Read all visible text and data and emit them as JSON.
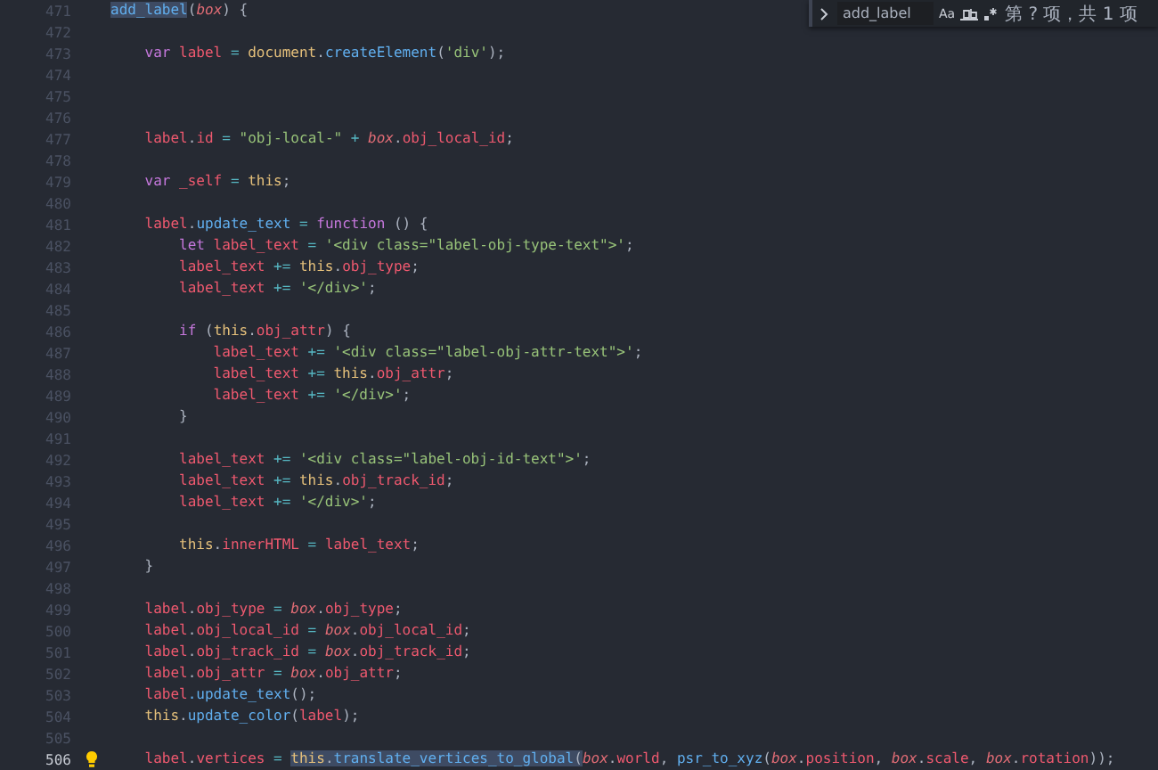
{
  "find_widget": {
    "query": "add_label",
    "match_case_label": "Aa",
    "result": "第 ? 项，共 1 项"
  },
  "editor": {
    "lines": [
      {
        "n": "471",
        "current": false,
        "tokens": [
          {
            "text": "add_label",
            "kind": "fn",
            "highlighted": true
          },
          {
            "text": "(",
            "kind": "punc"
          },
          {
            "text": "box",
            "kind": "param"
          },
          {
            "text": ") {",
            "kind": "punc"
          }
        ]
      },
      {
        "n": "472",
        "current": false
      },
      {
        "n": "473",
        "current": false,
        "tokens": [
          {
            "text": "    var",
            "kind": "kw"
          },
          {
            "text": " label",
            "kind": "var"
          },
          {
            "text": " = ",
            "kind": "op"
          },
          {
            "text": "document",
            "kind": "obj"
          },
          {
            "text": ".",
            "kind": "punc"
          },
          {
            "text": "createElement",
            "kind": "fn"
          },
          {
            "text": "(",
            "kind": "punc"
          },
          {
            "text": "'div'",
            "kind": "str"
          },
          {
            "text": ");",
            "kind": "punc"
          }
        ]
      },
      {
        "n": "474",
        "current": false
      },
      {
        "n": "475",
        "current": false
      },
      {
        "n": "476",
        "current": false
      },
      {
        "n": "477",
        "current": false,
        "tokens": [
          {
            "text": "    label",
            "kind": "var"
          },
          {
            "text": ".",
            "kind": "punc"
          },
          {
            "text": "id",
            "kind": "var"
          },
          {
            "text": " = ",
            "kind": "op"
          },
          {
            "text": "\"obj-local-\"",
            "kind": "str"
          },
          {
            "text": " + ",
            "kind": "op"
          },
          {
            "text": "box",
            "kind": "param"
          },
          {
            "text": ".",
            "kind": "punc"
          },
          {
            "text": "obj_local_id",
            "kind": "var"
          },
          {
            "text": ";",
            "kind": "punc"
          }
        ]
      },
      {
        "n": "478",
        "current": false
      },
      {
        "n": "479",
        "current": false,
        "tokens": [
          {
            "text": "    var",
            "kind": "kw"
          },
          {
            "text": " _self",
            "kind": "var"
          },
          {
            "text": " = ",
            "kind": "op"
          },
          {
            "text": "this",
            "kind": "this"
          },
          {
            "text": ";",
            "kind": "punc"
          }
        ]
      },
      {
        "n": "480",
        "current": false
      },
      {
        "n": "481",
        "current": false,
        "tokens": [
          {
            "text": "    label",
            "kind": "var"
          },
          {
            "text": ".",
            "kind": "punc"
          },
          {
            "text": "update_text",
            "kind": "fn"
          },
          {
            "text": " = ",
            "kind": "op"
          },
          {
            "text": "function",
            "kind": "kw"
          },
          {
            "text": " () {",
            "kind": "punc"
          }
        ]
      },
      {
        "n": "482",
        "current": false,
        "tokens": [
          {
            "text": "        let",
            "kind": "kw"
          },
          {
            "text": " label_text",
            "kind": "var"
          },
          {
            "text": " = ",
            "kind": "op"
          },
          {
            "text": "'<div class=\"label-obj-type-text\">'",
            "kind": "str"
          },
          {
            "text": ";",
            "kind": "punc"
          }
        ]
      },
      {
        "n": "483",
        "current": false,
        "tokens": [
          {
            "text": "        label_text",
            "kind": "var"
          },
          {
            "text": " += ",
            "kind": "op"
          },
          {
            "text": "this",
            "kind": "this"
          },
          {
            "text": ".",
            "kind": "punc"
          },
          {
            "text": "obj_type",
            "kind": "var"
          },
          {
            "text": ";",
            "kind": "punc"
          }
        ]
      },
      {
        "n": "484",
        "current": false,
        "tokens": [
          {
            "text": "        label_text",
            "kind": "var"
          },
          {
            "text": " += ",
            "kind": "op"
          },
          {
            "text": "'</div>'",
            "kind": "str"
          },
          {
            "text": ";",
            "kind": "punc"
          }
        ]
      },
      {
        "n": "485",
        "current": false
      },
      {
        "n": "486",
        "current": false,
        "tokens": [
          {
            "text": "        if",
            "kind": "kw"
          },
          {
            "text": " (",
            "kind": "punc"
          },
          {
            "text": "this",
            "kind": "this"
          },
          {
            "text": ".",
            "kind": "punc"
          },
          {
            "text": "obj_attr",
            "kind": "var"
          },
          {
            "text": ") {",
            "kind": "punc"
          }
        ]
      },
      {
        "n": "487",
        "current": false,
        "tokens": [
          {
            "text": "            label_text",
            "kind": "var"
          },
          {
            "text": " += ",
            "kind": "op"
          },
          {
            "text": "'<div class=\"label-obj-attr-text\">'",
            "kind": "str"
          },
          {
            "text": ";",
            "kind": "punc"
          }
        ]
      },
      {
        "n": "488",
        "current": false,
        "tokens": [
          {
            "text": "            label_text",
            "kind": "var"
          },
          {
            "text": " += ",
            "kind": "op"
          },
          {
            "text": "this",
            "kind": "this"
          },
          {
            "text": ".",
            "kind": "punc"
          },
          {
            "text": "obj_attr",
            "kind": "var"
          },
          {
            "text": ";",
            "kind": "punc"
          }
        ]
      },
      {
        "n": "489",
        "current": false,
        "tokens": [
          {
            "text": "            label_text",
            "kind": "var"
          },
          {
            "text": " += ",
            "kind": "op"
          },
          {
            "text": "'</div>'",
            "kind": "str"
          },
          {
            "text": ";",
            "kind": "punc"
          }
        ]
      },
      {
        "n": "490",
        "current": false,
        "tokens": [
          {
            "text": "        }",
            "kind": "punc"
          }
        ]
      },
      {
        "n": "491",
        "current": false
      },
      {
        "n": "492",
        "current": false,
        "tokens": [
          {
            "text": "        label_text",
            "kind": "var"
          },
          {
            "text": " += ",
            "kind": "op"
          },
          {
            "text": "'<div class=\"label-obj-id-text\">'",
            "kind": "str"
          },
          {
            "text": ";",
            "kind": "punc"
          }
        ]
      },
      {
        "n": "493",
        "current": false,
        "tokens": [
          {
            "text": "        label_text",
            "kind": "var"
          },
          {
            "text": " += ",
            "kind": "op"
          },
          {
            "text": "this",
            "kind": "this"
          },
          {
            "text": ".",
            "kind": "punc"
          },
          {
            "text": "obj_track_id",
            "kind": "var"
          },
          {
            "text": ";",
            "kind": "punc"
          }
        ]
      },
      {
        "n": "494",
        "current": false,
        "tokens": [
          {
            "text": "        label_text",
            "kind": "var"
          },
          {
            "text": " += ",
            "kind": "op"
          },
          {
            "text": "'</div>'",
            "kind": "str"
          },
          {
            "text": ";",
            "kind": "punc"
          }
        ]
      },
      {
        "n": "495",
        "current": false
      },
      {
        "n": "496",
        "current": false,
        "tokens": [
          {
            "text": "        this",
            "kind": "this"
          },
          {
            "text": ".",
            "kind": "punc"
          },
          {
            "text": "innerHTML",
            "kind": "var"
          },
          {
            "text": " = ",
            "kind": "op"
          },
          {
            "text": "label_text",
            "kind": "var"
          },
          {
            "text": ";",
            "kind": "punc"
          }
        ]
      },
      {
        "n": "497",
        "current": false,
        "tokens": [
          {
            "text": "    }",
            "kind": "punc"
          }
        ]
      },
      {
        "n": "498",
        "current": false
      },
      {
        "n": "499",
        "current": false,
        "tokens": [
          {
            "text": "    label",
            "kind": "var"
          },
          {
            "text": ".",
            "kind": "punc"
          },
          {
            "text": "obj_type",
            "kind": "var"
          },
          {
            "text": " = ",
            "kind": "op"
          },
          {
            "text": "box",
            "kind": "param"
          },
          {
            "text": ".",
            "kind": "punc"
          },
          {
            "text": "obj_type",
            "kind": "var"
          },
          {
            "text": ";",
            "kind": "punc"
          }
        ]
      },
      {
        "n": "500",
        "current": false,
        "tokens": [
          {
            "text": "    label",
            "kind": "var"
          },
          {
            "text": ".",
            "kind": "punc"
          },
          {
            "text": "obj_local_id",
            "kind": "var"
          },
          {
            "text": " = ",
            "kind": "op"
          },
          {
            "text": "box",
            "kind": "param"
          },
          {
            "text": ".",
            "kind": "punc"
          },
          {
            "text": "obj_local_id",
            "kind": "var"
          },
          {
            "text": ";",
            "kind": "punc"
          }
        ]
      },
      {
        "n": "501",
        "current": false,
        "tokens": [
          {
            "text": "    label",
            "kind": "var"
          },
          {
            "text": ".",
            "kind": "punc"
          },
          {
            "text": "obj_track_id",
            "kind": "var"
          },
          {
            "text": " = ",
            "kind": "op"
          },
          {
            "text": "box",
            "kind": "param"
          },
          {
            "text": ".",
            "kind": "punc"
          },
          {
            "text": "obj_track_id",
            "kind": "var"
          },
          {
            "text": ";",
            "kind": "punc"
          }
        ]
      },
      {
        "n": "502",
        "current": false,
        "tokens": [
          {
            "text": "    label",
            "kind": "var"
          },
          {
            "text": ".",
            "kind": "punc"
          },
          {
            "text": "obj_attr",
            "kind": "var"
          },
          {
            "text": " = ",
            "kind": "op"
          },
          {
            "text": "box",
            "kind": "param"
          },
          {
            "text": ".",
            "kind": "punc"
          },
          {
            "text": "obj_attr",
            "kind": "var"
          },
          {
            "text": ";",
            "kind": "punc"
          }
        ]
      },
      {
        "n": "503",
        "current": false,
        "tokens": [
          {
            "text": "    label",
            "kind": "var"
          },
          {
            "text": ".update_text",
            "kind": "fn"
          },
          {
            "text": "();",
            "kind": "punc"
          }
        ]
      },
      {
        "n": "504",
        "current": false,
        "tokens": [
          {
            "text": "    this",
            "kind": "this"
          },
          {
            "text": ".",
            "kind": "punc"
          },
          {
            "text": "update_color",
            "kind": "fn"
          },
          {
            "text": "(",
            "kind": "punc"
          },
          {
            "text": "label",
            "kind": "var"
          },
          {
            "text": ");",
            "kind": "punc"
          }
        ]
      },
      {
        "n": "505",
        "current": false
      },
      {
        "n": "506",
        "current": true,
        "tokens": [
          {
            "text": "    label",
            "kind": "var"
          },
          {
            "text": ".",
            "kind": "punc"
          },
          {
            "text": "vertices",
            "kind": "var"
          },
          {
            "text": " = ",
            "kind": "op"
          },
          {
            "text": "this",
            "kind": "this",
            "highlighted": true
          },
          {
            "text": ".",
            "kind": "punc",
            "highlighted": true
          },
          {
            "text": "translate_vertices_to_global",
            "kind": "fn",
            "highlighted": true
          },
          {
            "text": "(",
            "kind": "punc",
            "highlighted": true
          },
          {
            "text": "box",
            "kind": "param"
          },
          {
            "text": ".",
            "kind": "punc"
          },
          {
            "text": "world",
            "kind": "var"
          },
          {
            "text": ", ",
            "kind": "punc"
          },
          {
            "text": "psr_to_xyz",
            "kind": "fn"
          },
          {
            "text": "(",
            "kind": "punc"
          },
          {
            "text": "box",
            "kind": "param"
          },
          {
            "text": ".",
            "kind": "punc"
          },
          {
            "text": "position",
            "kind": "var"
          },
          {
            "text": ", ",
            "kind": "punc"
          },
          {
            "text": "box",
            "kind": "param"
          },
          {
            "text": ".",
            "kind": "punc"
          },
          {
            "text": "scale",
            "kind": "var"
          },
          {
            "text": ", ",
            "kind": "punc"
          },
          {
            "text": "box",
            "kind": "param"
          },
          {
            "text": ".",
            "kind": "punc"
          },
          {
            "text": "rotation",
            "kind": "var"
          },
          {
            "text": "));",
            "kind": "punc"
          }
        ]
      }
    ]
  }
}
